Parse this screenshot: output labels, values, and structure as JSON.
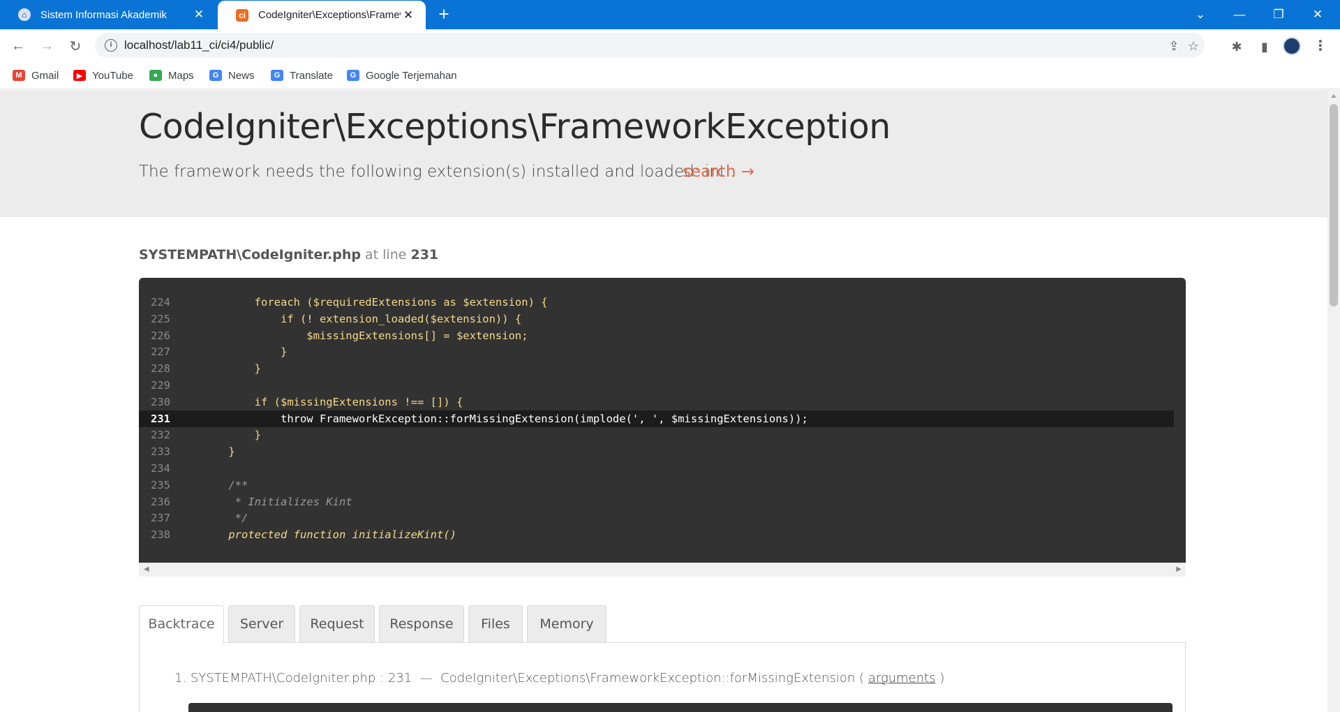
{
  "browser": {
    "tabs": [
      {
        "title": "Sistem Informasi Akademik",
        "favicon": "university-icon",
        "active": false
      },
      {
        "title": "CodeIgniter\\Exceptions\\FrameworkException",
        "favicon": "codeigniter-icon",
        "active": true
      }
    ],
    "close_glyph": "✕",
    "new_tab_glyph": "+",
    "url": "localhost/lab11_ci/ci4/public/",
    "bookmarks": [
      {
        "label": "Gmail",
        "icon": "gmail-icon",
        "color": "#ea4335"
      },
      {
        "label": "YouTube",
        "icon": "youtube-icon",
        "color": "#ff0000"
      },
      {
        "label": "Maps",
        "icon": "maps-icon",
        "color": "#34a853"
      },
      {
        "label": "News",
        "icon": "news-icon",
        "color": "#4285f4"
      },
      {
        "label": "Translate",
        "icon": "translate-icon",
        "color": "#4285f4"
      },
      {
        "label": "Google Terjemahan",
        "icon": "translate-icon",
        "color": "#4285f4"
      }
    ]
  },
  "error": {
    "title": "CodeIgniter\\Exceptions\\FrameworkException",
    "message": "The framework needs the following extension(s) installed and loaded: intl.",
    "search_label": "search →",
    "source_file": "SYSTEMPATH\\CodeIgniter.php",
    "at_line_text": "at line",
    "line_number": "231"
  },
  "code": [
    {
      "line": "224",
      "text": "        foreach ($requiredExtensions as $extension) {",
      "style": "normal"
    },
    {
      "line": "225",
      "text": "            if (! extension_loaded($extension)) {",
      "style": "normal"
    },
    {
      "line": "226",
      "text": "                $missingExtensions[] = $extension;",
      "style": "normal"
    },
    {
      "line": "227",
      "text": "            }",
      "style": "normal"
    },
    {
      "line": "228",
      "text": "        }",
      "style": "normal"
    },
    {
      "line": "229",
      "text": "",
      "style": "normal"
    },
    {
      "line": "230",
      "text": "        if ($missingExtensions !== []) {",
      "style": "normal"
    },
    {
      "line": "231",
      "text": "            throw FrameworkException::forMissingExtension(implode(', ', $missingExtensions));",
      "style": "highlight"
    },
    {
      "line": "232",
      "text": "        }",
      "style": "normal"
    },
    {
      "line": "233",
      "text": "    }",
      "style": "normal"
    },
    {
      "line": "234",
      "text": "",
      "style": "normal"
    },
    {
      "line": "235",
      "text": "    /**",
      "style": "comment"
    },
    {
      "line": "236",
      "text": "     * Initializes Kint",
      "style": "comment"
    },
    {
      "line": "237",
      "text": "     */",
      "style": "comment"
    },
    {
      "line": "238",
      "text": "    protected function initializeKint()",
      "style": "keyword"
    }
  ],
  "tabs": [
    "Backtrace",
    "Server",
    "Request",
    "Response",
    "Files",
    "Memory"
  ],
  "active_tab": "Backtrace",
  "backtrace": {
    "index": "1.",
    "file": "SYSTEMPATH\\CodeIgniter.php : 231",
    "separator": "—",
    "function": "CodeIgniter\\Exceptions\\FrameworkException::forMissingExtension",
    "open_paren": "(",
    "arguments_link": "arguments",
    "close_paren": ")"
  }
}
